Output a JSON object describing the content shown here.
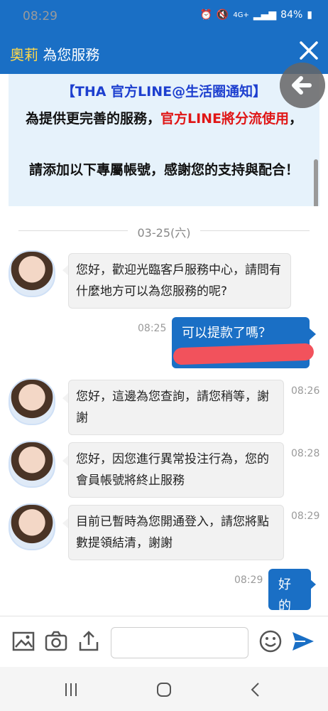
{
  "status": {
    "time": "08:29",
    "battery": "84%",
    "signal_text": "4G+"
  },
  "header": {
    "name": "奧莉",
    "suffix": " 為您服務"
  },
  "notice": {
    "title": "【THA 官方LINE@生活圈通知】",
    "line2_prefix": "為提供更完善的服務，",
    "line2_red": "官方LINE將分流使用",
    "line2_suffix": "，",
    "line3": "請添加以下專屬帳號，感謝您的支持與配合！"
  },
  "date_separator": "03-25(六)",
  "messages": [
    {
      "side": "in",
      "text": "您好，歡迎光臨客戶服務中心，請問有什麼地方可以為您服務的呢?",
      "time": ""
    },
    {
      "side": "out",
      "text": "可以提款了嗎？",
      "time": "08:25"
    },
    {
      "side": "in",
      "text": "您好，這邊為您查詢，請您稍等，謝謝",
      "time": "08:26"
    },
    {
      "side": "in",
      "text": "您好，因您進行異常投注行為，您的會員帳號將終止服務",
      "time": "08:28"
    },
    {
      "side": "in",
      "text": "目前已暫時為您開通登入，請您將點數提領結清，謝謝",
      "time": "08:29"
    },
    {
      "side": "out",
      "text": "好的",
      "time": "08:29"
    }
  ],
  "colors": {
    "accent": "#1a6fc5",
    "highlight": "#ffd84a",
    "notice_title": "#1d3fcf",
    "notice_red": "#e01616"
  },
  "icons": {
    "close": "close-icon",
    "back": "arrow-left-icon",
    "image": "image-icon",
    "camera": "camera-icon",
    "upload": "upload-icon",
    "emoji": "emoji-icon",
    "send": "send-icon"
  }
}
